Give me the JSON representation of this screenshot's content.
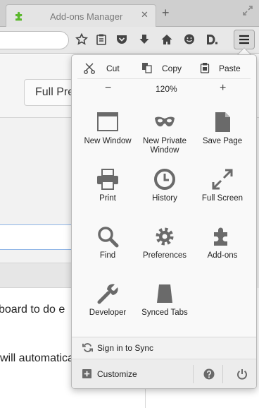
{
  "tab": {
    "title": "Add-ons Manager",
    "close_symbol": "✕"
  },
  "new_tab_symbol": "+",
  "background": {
    "preview_button": "Full Preview",
    "line1": "board to do e",
    "line2": "will automaticall"
  },
  "menu": {
    "edit": {
      "cut": "Cut",
      "copy": "Copy",
      "paste": "Paste"
    },
    "zoom": {
      "minus": "−",
      "value": "120%",
      "plus": "+"
    },
    "items": [
      {
        "label": "New Window",
        "icon": "new-window-icon"
      },
      {
        "label": "New Private Window",
        "icon": "private-mask-icon"
      },
      {
        "label": "Save Page",
        "icon": "save-page-icon"
      },
      {
        "label": "Print",
        "icon": "print-icon"
      },
      {
        "label": "History",
        "icon": "history-icon"
      },
      {
        "label": "Full Screen",
        "icon": "full-screen-icon"
      },
      {
        "label": "Find",
        "icon": "find-icon"
      },
      {
        "label": "Preferences",
        "icon": "gear-icon"
      },
      {
        "label": "Add-ons",
        "icon": "puzzle-icon"
      },
      {
        "label": "Developer",
        "icon": "wrench-icon"
      },
      {
        "label": "Synced Tabs",
        "icon": "synced-tabs-icon"
      }
    ],
    "sync_label": "Sign in to Sync",
    "customize_label": "Customize"
  },
  "colors": {
    "icon_gray": "#6a6a6a",
    "panel_bg": "#f9f9f9",
    "favicon_green": "#5cb82e"
  }
}
